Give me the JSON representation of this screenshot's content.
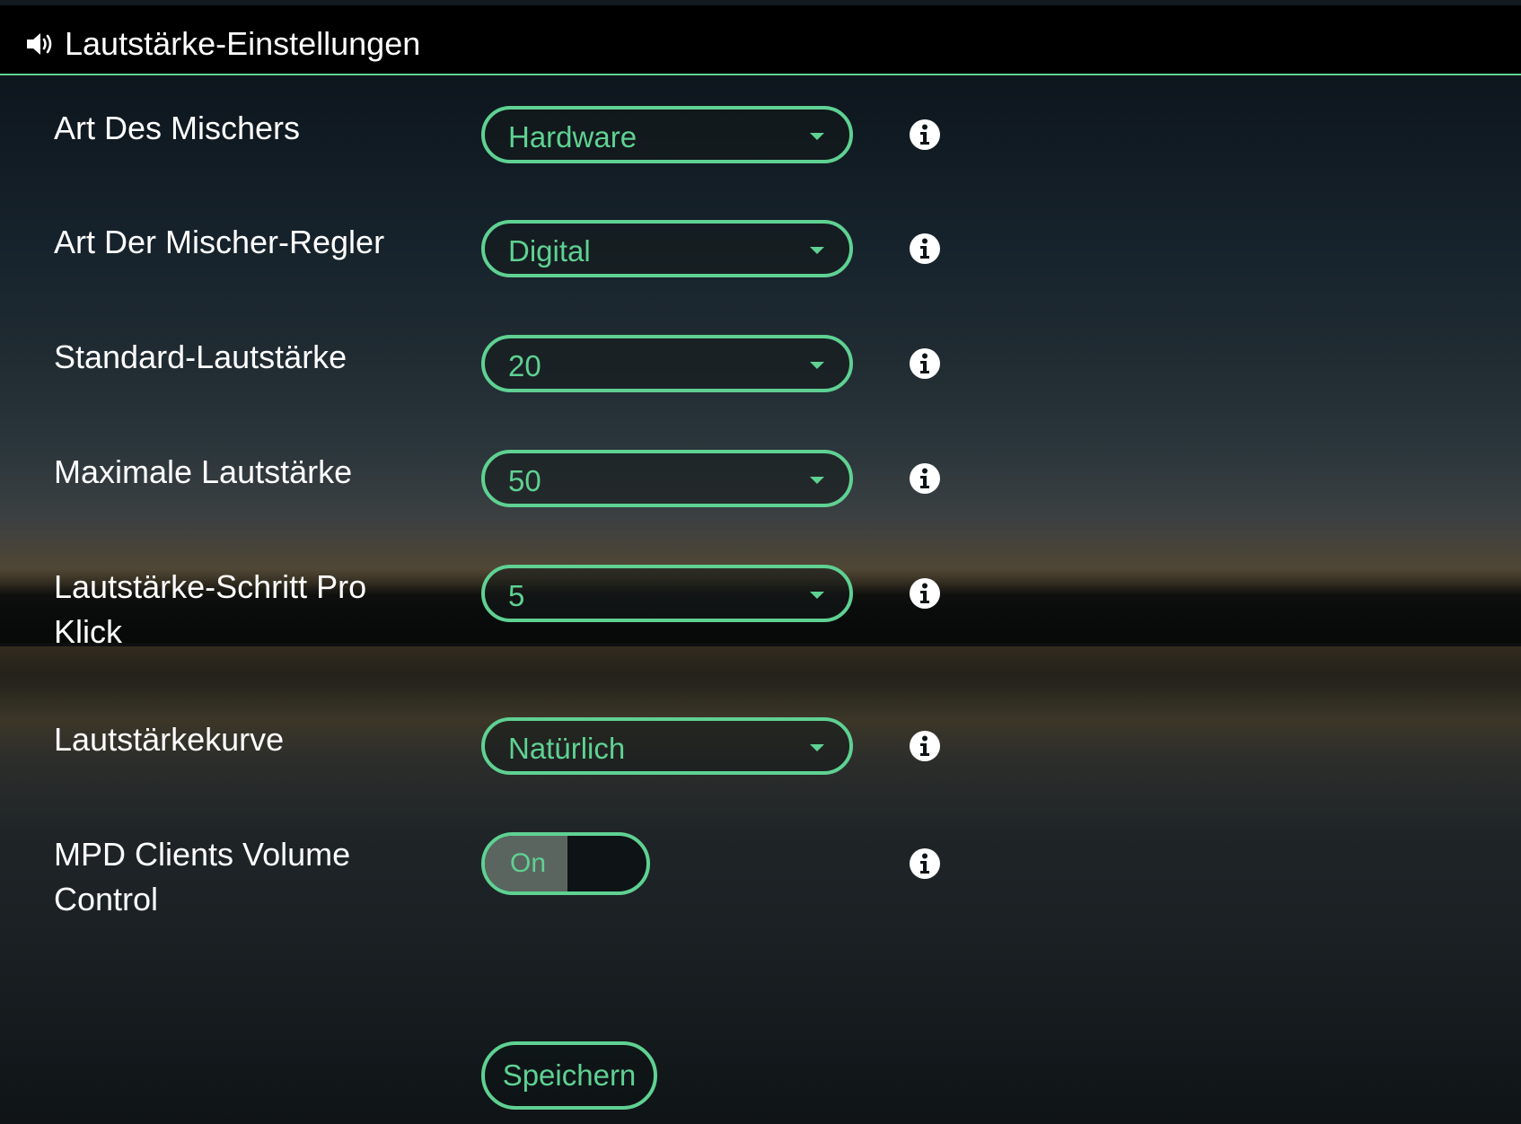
{
  "header": {
    "title": "Lautstärke-Einstellungen",
    "icon": "speaker-icon"
  },
  "settings": [
    {
      "label": "Art Des Mischers",
      "value": "Hardware",
      "control": "select"
    },
    {
      "label": "Art Der Mischer-Regler",
      "value": "Digital",
      "control": "select"
    },
    {
      "label": "Standard-Lautstärke",
      "value": "20",
      "control": "select"
    },
    {
      "label": "Maximale Lautstärke",
      "value": "50",
      "control": "select"
    },
    {
      "label": "Lautstärke-Schritt Pro Klick",
      "value": "5",
      "control": "select"
    },
    {
      "label": "Lautstärkekurve",
      "value": "Natürlich",
      "control": "select"
    },
    {
      "label": "MPD Clients Volume Control",
      "value": "On",
      "control": "toggle"
    }
  ],
  "save_label": "Speichern",
  "colors": {
    "accent": "#5fd192",
    "topbar": "#000000",
    "text": "#ffffff"
  }
}
